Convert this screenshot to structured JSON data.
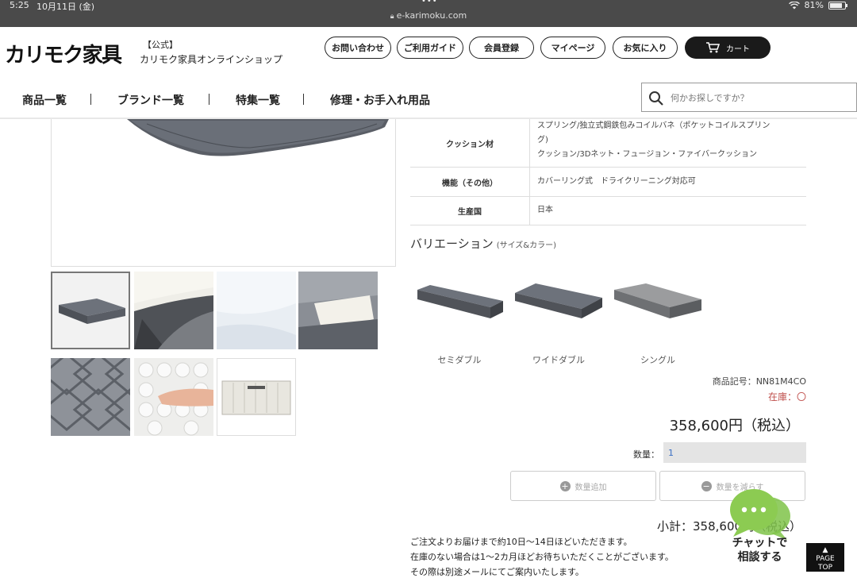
{
  "status_bar": {
    "time": "5:25",
    "date": "10月11日 (金)",
    "url": "e-karimoku.com",
    "battery": "81%",
    "battery_fraction": 0.81
  },
  "header": {
    "logo_text": "カリモク家具",
    "official_label": "【公式】",
    "shop_name": "カリモク家具オンラインショップ",
    "buttons": [
      "お問い合わせ",
      "ご利用ガイド",
      "会員登録",
      "マイページ",
      "お気に入り"
    ],
    "cart_label": "カート"
  },
  "nav": {
    "items": [
      "商品一覧",
      "ブランド一覧",
      "特集一覧",
      "修理・お手入れ用品"
    ]
  },
  "search": {
    "placeholder": "何かお探しですか？"
  },
  "specs": [
    {
      "key": "クッション材",
      "lines": [
        "スプリング/独立式鋼鉄包みコイルバネ（ポケットコイルスプリン",
        "グ)",
        "クッション/3Dネット・フュージョン・ファイバークッション"
      ]
    },
    {
      "key": "機能（その他）",
      "lines": [
        "カバーリング式　ドライクリーニング対応可"
      ]
    },
    {
      "key": "生産国",
      "lines": [
        "日本"
      ]
    }
  ],
  "variation": {
    "title": "バリエーション",
    "subtitle": "(サイズ&カラー)",
    "items": [
      "セミダブル",
      "ワイドダブル",
      "シングル"
    ]
  },
  "product": {
    "code": "商品記号：NN81M4CO",
    "stock": "在庫：〇",
    "price": "358,600円（税込）",
    "qty_label": "数量：",
    "qty_value": "1",
    "add_label": "数量追加",
    "sub_label": "数量を減らす",
    "subtotal": "小計：358,600円（税込）"
  },
  "notes": [
    "ご注文よりお届けまで約10日〜14日ほどいただきます。",
    "在庫のない場合は1〜2カ月ほどお待ちいただくことがございます。",
    "その際は別途メールにてご案内いたします。"
  ],
  "chat": {
    "line1": "チャットで",
    "line2": "相談する"
  },
  "page_top": {
    "line1": "PAGE",
    "line2": "TOP"
  }
}
